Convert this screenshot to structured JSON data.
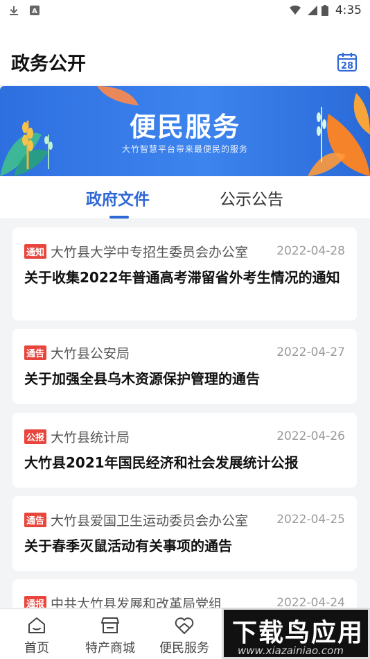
{
  "status_bar": {
    "time": "4:35",
    "left_icons": [
      "download-icon",
      "font-a-icon"
    ],
    "right_icons": [
      "wifi-icon",
      "cellular-icon",
      "battery-icon"
    ]
  },
  "header": {
    "title": "政务公开",
    "calendar_day": "28"
  },
  "banner": {
    "title": "便民服务",
    "subtitle": "大竹智慧平台带来最便民的服务"
  },
  "tabs": [
    {
      "label": "政府文件",
      "active": true
    },
    {
      "label": "公示公告",
      "active": false
    }
  ],
  "articles": [
    {
      "tag": "通知",
      "source": "大竹县大学中专招生委员会办公室",
      "date": "2022-04-28",
      "title": "关于收集2022年普通高考滞留省外考生情况的通知"
    },
    {
      "tag": "通告",
      "source": "大竹县公安局",
      "date": "2022-04-27",
      "title": "关于加强全县乌木资源保护管理的通告"
    },
    {
      "tag": "公报",
      "source": "大竹县统计局",
      "date": "2022-04-26",
      "title": "大竹县2021年国民经济和社会发展统计公报"
    },
    {
      "tag": "通告",
      "source": "大竹县爱国卫生运动委员会办公室",
      "date": "2022-04-25",
      "title": "关于春季灭鼠活动有关事项的通告"
    },
    {
      "tag": "通报",
      "source": "中共大竹县发展和改革局党组",
      "date": "2022-04-24",
      "title": ""
    }
  ],
  "bottom_nav": [
    {
      "label": "首页",
      "icon": "home-icon"
    },
    {
      "label": "特产商城",
      "icon": "shop-icon"
    },
    {
      "label": "便民服务",
      "icon": "heart-hands-icon"
    }
  ],
  "watermark": {
    "main": "下载鸟应用",
    "sub": "www.xiazainiao.com"
  },
  "colors": {
    "accent": "#2e68d6",
    "tag": "#e8453c",
    "banner": "#3d84ee"
  }
}
